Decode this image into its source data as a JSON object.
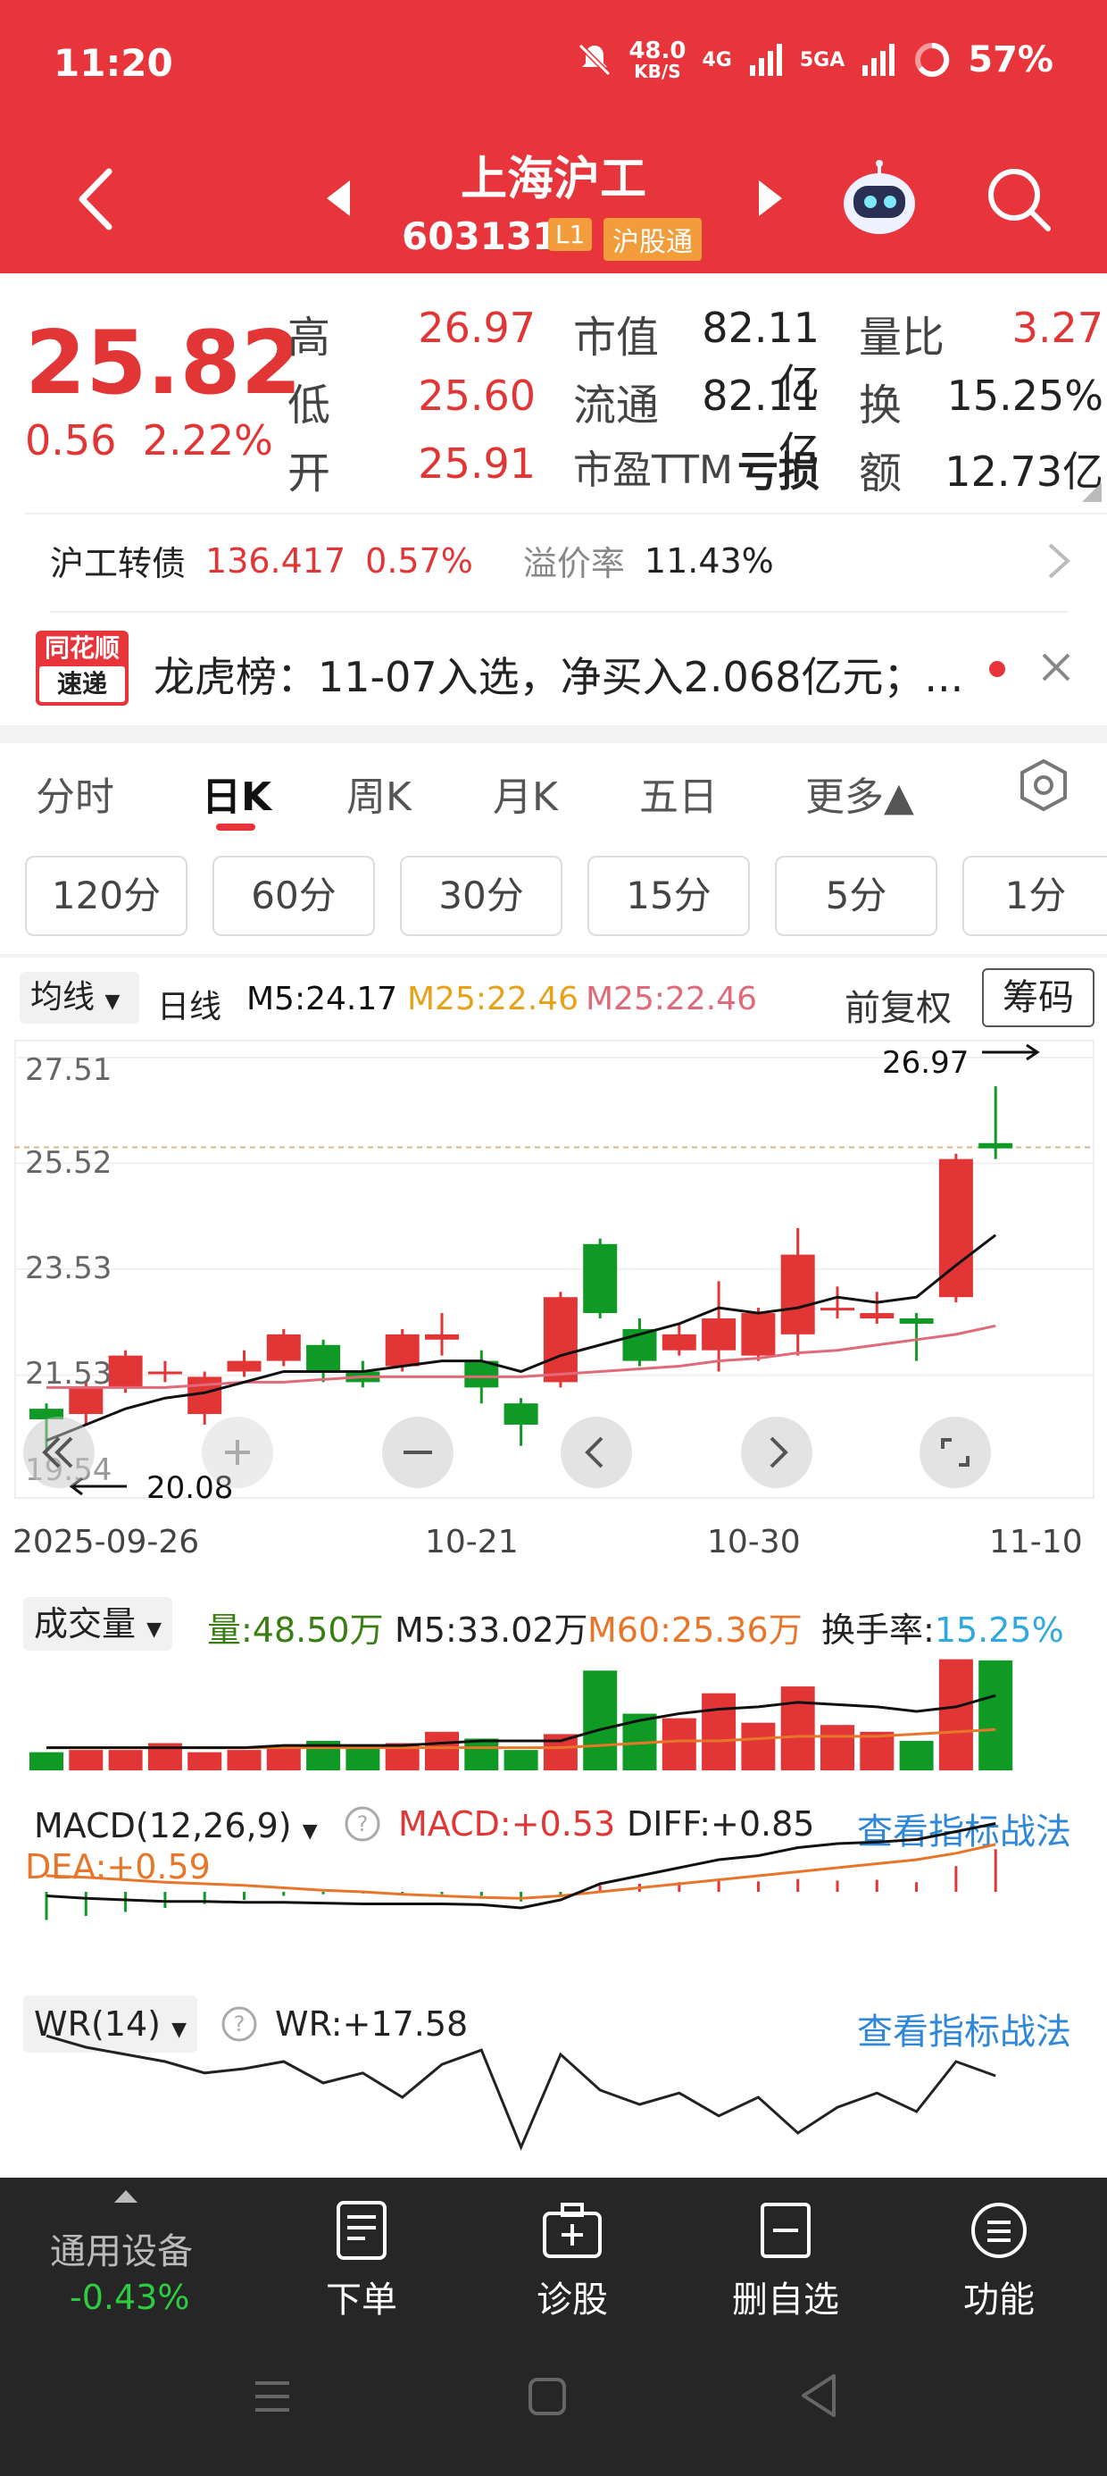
{
  "status_bar": {
    "time": "11:20",
    "net_speed": "48.0",
    "net_unit": "KB/S",
    "net_4g": "4G",
    "net_5g": "5GA",
    "battery": "57%"
  },
  "header": {
    "name": "上海沪工",
    "code": "603131",
    "badge_l1": "L1",
    "badge_hgt": "沪股通"
  },
  "quote": {
    "price": "25.82",
    "change": "0.56",
    "change_pct": "2.22%",
    "rows": [
      {
        "l1": "高",
        "v1": "26.97",
        "l2": "市值",
        "v2": "82.11亿",
        "l3": "量比",
        "v3": "3.27"
      },
      {
        "l1": "低",
        "v1": "25.60",
        "l2": "流通",
        "v2": "82.11亿",
        "l3": "换",
        "v3": "15.25%"
      },
      {
        "l1": "开",
        "v1": "25.91",
        "l2": "市盈TTM",
        "v2": "亏损",
        "l3": "额",
        "v3": "12.73亿"
      }
    ]
  },
  "convertible": {
    "name": "沪工转债",
    "price": "136.417",
    "pct": "0.57%",
    "premium_label": "溢价率",
    "premium": "11.43%"
  },
  "news": {
    "logo_top": "同花顺",
    "logo_bottom": "速递",
    "text": "龙虎榜：11-07入选，净买入2.068亿元；..."
  },
  "tabs": [
    "分时",
    "日K",
    "周K",
    "月K",
    "五日",
    "更多▲"
  ],
  "periods": [
    "120分",
    "60分",
    "30分",
    "15分",
    "5分",
    "1分"
  ],
  "ma_header": {
    "selector": "均线",
    "period": "日线",
    "m5": "M5:24.17",
    "m25a": "M25:22.46",
    "m25b": "M25:22.46",
    "adjust": "前复权",
    "chips": "筹码"
  },
  "price_axis": [
    "27.51",
    "25.52",
    "23.53",
    "21.53",
    "19.54"
  ],
  "dates": [
    "2025-09-26",
    "10-21",
    "10-30",
    "11-10"
  ],
  "annotations": {
    "high": "26.97",
    "low": "20.08"
  },
  "volume_header": {
    "selector": "成交量",
    "vol": "量:48.50万",
    "m5": "M5:33.02万",
    "m60": "M60:25.36万",
    "turnover_label": "换手率:",
    "turnover": "15.25%"
  },
  "macd_header": {
    "selector": "MACD(12,26,9)",
    "macd": "MACD:+0.53",
    "diff": "DIFF:+0.85",
    "dea": "DEA:+0.59",
    "link": "查看指标战法"
  },
  "wr_header": {
    "selector": "WR(14)",
    "wr": "WR:+17.58",
    "link": "查看指标战法"
  },
  "bottom_nav": {
    "market_name": "通用设备",
    "market_pct": "-0.43%",
    "items": [
      "下单",
      "诊股",
      "删自选",
      "功能"
    ]
  },
  "colors": {
    "up": "#e23636",
    "down": "#0e9a24",
    "brand": "#e8343b",
    "ma5": "#111111",
    "ma25": "#e8a21a",
    "ma25b": "#e06a7a",
    "blue": "#2f87d8"
  },
  "chart_data": {
    "type": "candlestick",
    "candles": [
      {
        "o": 20.9,
        "c": 20.7,
        "h": 21.0,
        "l": 20.1
      },
      {
        "o": 20.8,
        "c": 21.3,
        "h": 21.4,
        "l": 20.6
      },
      {
        "o": 21.3,
        "c": 21.9,
        "h": 22.0,
        "l": 21.2
      },
      {
        "o": 21.6,
        "c": 21.6,
        "h": 21.8,
        "l": 21.4
      },
      {
        "o": 20.8,
        "c": 21.5,
        "h": 21.6,
        "l": 20.6
      },
      {
        "o": 21.6,
        "c": 21.8,
        "h": 22.0,
        "l": 21.5
      },
      {
        "o": 21.8,
        "c": 22.3,
        "h": 22.4,
        "l": 21.7
      },
      {
        "o": 22.1,
        "c": 21.6,
        "h": 22.2,
        "l": 21.4
      },
      {
        "o": 21.6,
        "c": 21.4,
        "h": 21.8,
        "l": 21.3
      },
      {
        "o": 21.7,
        "c": 22.3,
        "h": 22.4,
        "l": 21.6
      },
      {
        "o": 22.2,
        "c": 22.3,
        "h": 22.7,
        "l": 21.9
      },
      {
        "o": 21.8,
        "c": 21.3,
        "h": 22.0,
        "l": 21.0
      },
      {
        "o": 21.0,
        "c": 20.6,
        "h": 21.1,
        "l": 20.2
      },
      {
        "o": 21.4,
        "c": 23.0,
        "h": 23.1,
        "l": 21.3
      },
      {
        "o": 24.0,
        "c": 22.7,
        "h": 24.1,
        "l": 22.6
      },
      {
        "o": 22.4,
        "c": 21.8,
        "h": 22.6,
        "l": 21.7
      },
      {
        "o": 22.0,
        "c": 22.3,
        "h": 22.5,
        "l": 21.9
      },
      {
        "o": 22.0,
        "c": 22.6,
        "h": 23.3,
        "l": 21.6
      },
      {
        "o": 21.9,
        "c": 22.7,
        "h": 22.8,
        "l": 21.8
      },
      {
        "o": 22.3,
        "c": 23.8,
        "h": 24.3,
        "l": 21.9
      },
      {
        "o": 22.8,
        "c": 22.8,
        "h": 23.2,
        "l": 22.6
      },
      {
        "o": 22.6,
        "c": 22.7,
        "h": 23.1,
        "l": 22.5
      },
      {
        "o": 22.6,
        "c": 22.5,
        "h": 22.7,
        "l": 21.8
      },
      {
        "o": 23.0,
        "c": 25.6,
        "h": 25.7,
        "l": 22.9
      },
      {
        "o": 25.9,
        "c": 25.8,
        "h": 26.97,
        "l": 25.6
      }
    ],
    "ma5": [
      20.3,
      20.6,
      20.9,
      21.1,
      21.2,
      21.4,
      21.6,
      21.6,
      21.6,
      21.7,
      21.8,
      21.8,
      21.6,
      21.9,
      22.1,
      22.3,
      22.5,
      22.8,
      22.7,
      22.8,
      23.0,
      22.9,
      23.0,
      23.6,
      24.17
    ],
    "ma25": [
      21.3,
      21.3,
      21.3,
      21.3,
      21.35,
      21.4,
      21.4,
      21.45,
      21.5,
      21.5,
      21.5,
      21.5,
      21.5,
      21.55,
      21.6,
      21.65,
      21.7,
      21.8,
      21.85,
      21.95,
      22.0,
      22.1,
      22.2,
      22.3,
      22.46
    ],
    "y_range": [
      19.54,
      27.51
    ],
    "volume": [
      8,
      9,
      9,
      12,
      8,
      9,
      11,
      13,
      11,
      12,
      17,
      14,
      9,
      16,
      44,
      25,
      23,
      34,
      21,
      37,
      20,
      17,
      13,
      49,
      48.5
    ],
    "volume_ma5": [
      10,
      10,
      10,
      10,
      10,
      10,
      11,
      11,
      11,
      11,
      12,
      13,
      13,
      13,
      18,
      22,
      25,
      27,
      28,
      30,
      29,
      28,
      26,
      28,
      33
    ],
    "volume_ma60": [
      10,
      10,
      10,
      10,
      10,
      10,
      10,
      10,
      10,
      10,
      10,
      10,
      10,
      10,
      11,
      12,
      13,
      13,
      14,
      15,
      15,
      15,
      16,
      17,
      18
    ],
    "macd_bars": [
      -0.35,
      -0.3,
      -0.25,
      -0.2,
      -0.15,
      -0.1,
      -0.05,
      -0.03,
      -0.02,
      -0.02,
      -0.03,
      -0.05,
      -0.12,
      -0.05,
      0.08,
      0.1,
      0.12,
      0.14,
      0.13,
      0.16,
      0.14,
      0.15,
      0.12,
      0.32,
      0.53
    ],
    "diff": [
      -0.05,
      -0.08,
      -0.1,
      -0.12,
      -0.12,
      -0.13,
      -0.13,
      -0.14,
      -0.15,
      -0.15,
      -0.15,
      -0.16,
      -0.2,
      -0.1,
      0.1,
      0.2,
      0.3,
      0.4,
      0.45,
      0.55,
      0.6,
      0.62,
      0.65,
      0.75,
      0.85
    ],
    "dea": [
      0.2,
      0.18,
      0.15,
      0.12,
      0.1,
      0.08,
      0.05,
      0.02,
      0.0,
      -0.03,
      -0.05,
      -0.07,
      -0.08,
      -0.05,
      0.0,
      0.05,
      0.1,
      0.15,
      0.2,
      0.25,
      0.3,
      0.35,
      0.4,
      0.48,
      0.59
    ],
    "wr": [
      98,
      90,
      85,
      80,
      72,
      75,
      80,
      65,
      72,
      55,
      78,
      88,
      20,
      85,
      60,
      50,
      58,
      42,
      55,
      30,
      48,
      58,
      45,
      80,
      70
    ]
  }
}
